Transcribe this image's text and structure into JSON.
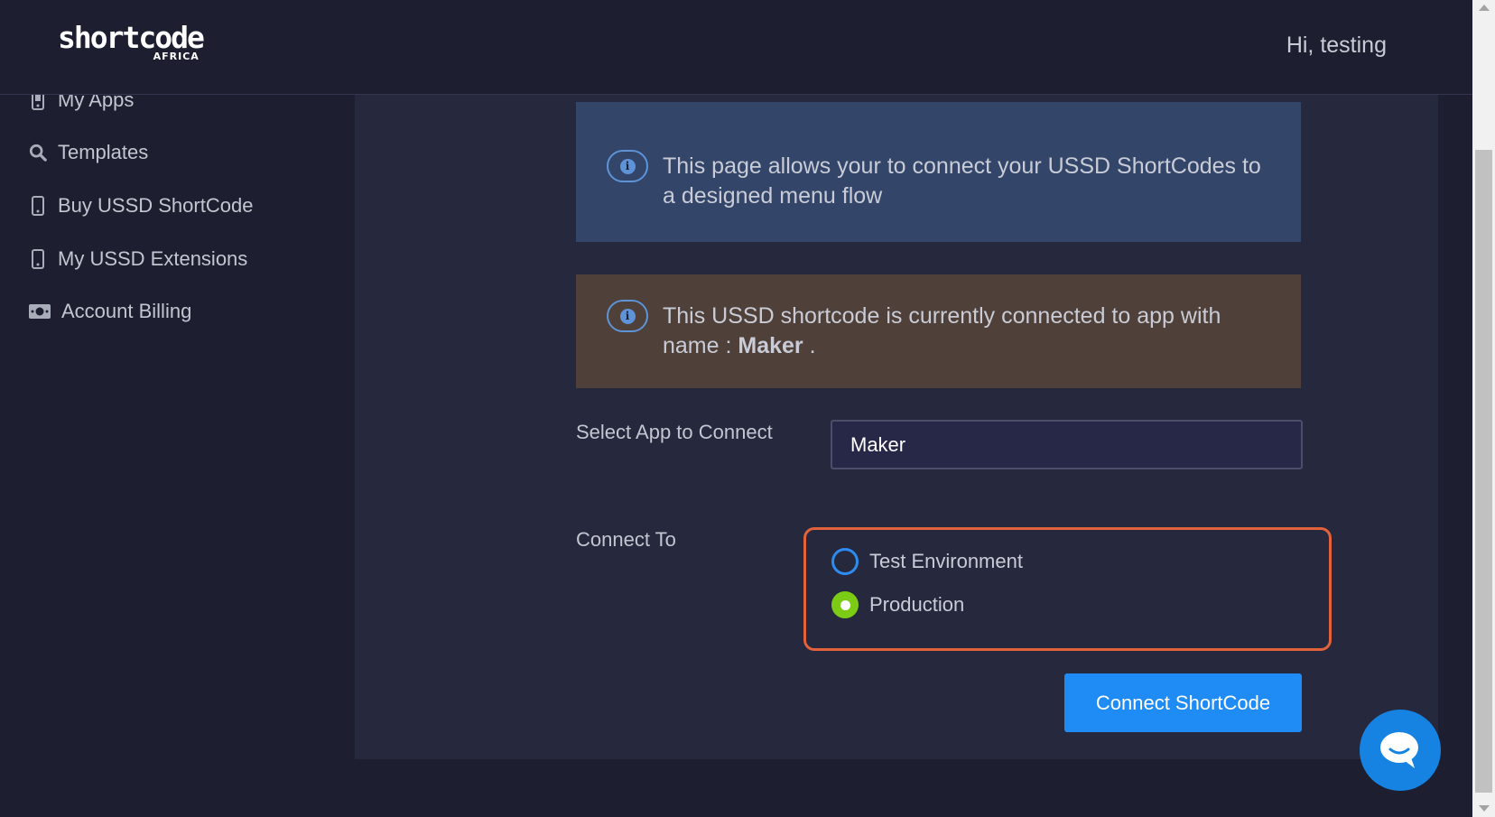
{
  "header": {
    "logo_main": "shortcode",
    "logo_sub": "AFRICA",
    "greeting": "Hi, testing"
  },
  "sidebar": {
    "items": [
      {
        "label": "My Apps",
        "icon": "mobile-icon"
      },
      {
        "label": "Templates",
        "icon": "search-icon"
      },
      {
        "label": "Buy USSD ShortCode",
        "icon": "mobile-icon"
      },
      {
        "label": "My USSD Extensions",
        "icon": "mobile-icon"
      },
      {
        "label": "Account Billing",
        "icon": "money-icon"
      }
    ]
  },
  "main": {
    "info_alert": "This page allows your to connect your USSD ShortCodes to a designed menu flow",
    "warning_alert": {
      "prefix": "This USSD shortcode is currently connected to app with name : ",
      "app_name": "Maker",
      "suffix": " ."
    },
    "select_label": "Select App to Connect",
    "select_value": "Maker",
    "connect_to_label": "Connect To",
    "radio_options": [
      {
        "label": "Test Environment",
        "selected": false
      },
      {
        "label": "Production",
        "selected": true
      }
    ],
    "connect_button": "Connect ShortCode"
  },
  "colors": {
    "accent": "#1f8bf5",
    "highlight_border": "#e2623b",
    "radio_selected": "#7ccb14",
    "info_bg": "#33466a",
    "warning_bg": "#4f4039"
  }
}
